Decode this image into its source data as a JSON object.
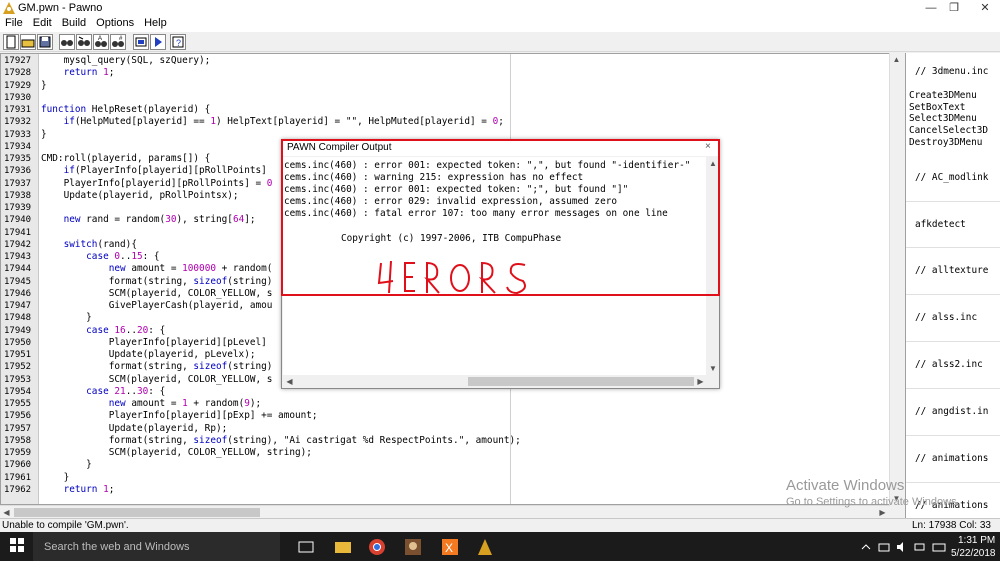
{
  "window": {
    "title": "GM.pwn - Pawno"
  },
  "menu": [
    "File",
    "Edit",
    "Build",
    "Options",
    "Help"
  ],
  "toolbar_icons": [
    "new-file-icon",
    "open-file-icon",
    "save-icon",
    "find-icon",
    "find-next-icon",
    "replace-icon",
    "goto-icon",
    "compile-icon",
    "run-icon",
    "help-icon"
  ],
  "editor": {
    "lines": [
      {
        "n": "17927",
        "code": "    mysql_query(SQL, szQuery);"
      },
      {
        "n": "17928",
        "code": "    return 1;"
      },
      {
        "n": "17929",
        "code": "}"
      },
      {
        "n": "17930",
        "code": ""
      },
      {
        "n": "17931",
        "code": "function HelpReset(playerid) {"
      },
      {
        "n": "17932",
        "code": "    if(HelpMuted[playerid] == 1) HelpText[playerid] = \"\", HelpMuted[playerid] = 0;"
      },
      {
        "n": "17933",
        "code": "}"
      },
      {
        "n": "17934",
        "code": ""
      },
      {
        "n": "17935",
        "code": "CMD:roll(playerid, params[]) {"
      },
      {
        "n": "17936",
        "code": "    if(PlayerInfo[playerid][pRollPoints]"
      },
      {
        "n": "17937",
        "code": "    PlayerInfo[playerid][pRollPoints] = 0"
      },
      {
        "n": "17938",
        "code": "    Update(playerid, pRollPointsx);"
      },
      {
        "n": "17939",
        "code": ""
      },
      {
        "n": "17940",
        "code": "    new rand = random(30), string[64];"
      },
      {
        "n": "17941",
        "code": ""
      },
      {
        "n": "17942",
        "code": "    switch(rand){"
      },
      {
        "n": "17943",
        "code": "        case 0..15: {"
      },
      {
        "n": "17944",
        "code": "            new amount = 100000 + random("
      },
      {
        "n": "17945",
        "code": "            format(string, sizeof(string)"
      },
      {
        "n": "17946",
        "code": "            SCM(playerid, COLOR_YELLOW, s"
      },
      {
        "n": "17947",
        "code": "            GivePlayerCash(playerid, amou"
      },
      {
        "n": "17948",
        "code": "        }"
      },
      {
        "n": "17949",
        "code": "        case 16..20: {"
      },
      {
        "n": "17950",
        "code": "            PlayerInfo[playerid][pLevel]"
      },
      {
        "n": "17951",
        "code": "            Update(playerid, pLevelx);"
      },
      {
        "n": "17952",
        "code": "            format(string, sizeof(string)"
      },
      {
        "n": "17953",
        "code": "            SCM(playerid, COLOR_YELLOW, s"
      },
      {
        "n": "17954",
        "code": "        case 21..30: {"
      },
      {
        "n": "17955",
        "code": "            new amount = 1 + random(9);"
      },
      {
        "n": "17956",
        "code": "            PlayerInfo[playerid][pExp] += amount;"
      },
      {
        "n": "17957",
        "code": "            Update(playerid, Rp);"
      },
      {
        "n": "17958",
        "code": "            format(string, sizeof(string), \"Ai castrigat %d RespectPoints.\", amount);"
      },
      {
        "n": "17959",
        "code": "            SCM(playerid, COLOR_YELLOW, string);"
      },
      {
        "n": "17960",
        "code": "        }"
      },
      {
        "n": "17961",
        "code": "    }"
      },
      {
        "n": "17962",
        "code": "    return 1;"
      }
    ]
  },
  "right_panel": [
    {
      "text": "// 3dmenu.inc",
      "kind": "header"
    },
    {
      "text": "",
      "kind": "gap"
    },
    {
      "text": "Create3DMenu",
      "kind": "item"
    },
    {
      "text": "SetBoxText",
      "kind": "item"
    },
    {
      "text": "Select3DMenu",
      "kind": "item"
    },
    {
      "text": "CancelSelect3D",
      "kind": "item"
    },
    {
      "text": "Destroy3DMenu",
      "kind": "item"
    },
    {
      "text": "// AC_modlink",
      "kind": "header"
    },
    {
      "text": "afkdetect",
      "kind": "header"
    },
    {
      "text": "// alltexture",
      "kind": "header"
    },
    {
      "text": "// alss.inc",
      "kind": "header"
    },
    {
      "text": "// alss2.inc",
      "kind": "header"
    },
    {
      "text": "// angdist.in",
      "kind": "header"
    },
    {
      "text": "// animations",
      "kind": "header"
    },
    {
      "text": "// animations",
      "kind": "header"
    }
  ],
  "compiler": {
    "title": "PAWN Compiler Output",
    "close": "×",
    "lines": [
      "cems.inc(460) : error 001: expected token: \",\", but found \"-identifier-\"",
      "cems.inc(460) : warning 215: expression has no effect",
      "cems.inc(460) : error 001: expected token: \";\", but found \"]\"",
      "cems.inc(460) : error 029: invalid expression, assumed zero",
      "cems.inc(460) : fatal error 107: too many error messages on one line"
    ],
    "copyright": "Copyright (c) 1997-2006, ITB CompuPhase",
    "handwriting": "4ERORS"
  },
  "status": {
    "message": "Unable to compile 'GM.pwn'.",
    "position": "Ln: 17938   Col: 33"
  },
  "watermark": {
    "line1": "Activate Windows",
    "line2": "Go to Settings to activate Windows."
  },
  "taskbar": {
    "search_placeholder": "Search the web and Windows",
    "time": "1:31 PM",
    "date": "5/22/2018"
  }
}
